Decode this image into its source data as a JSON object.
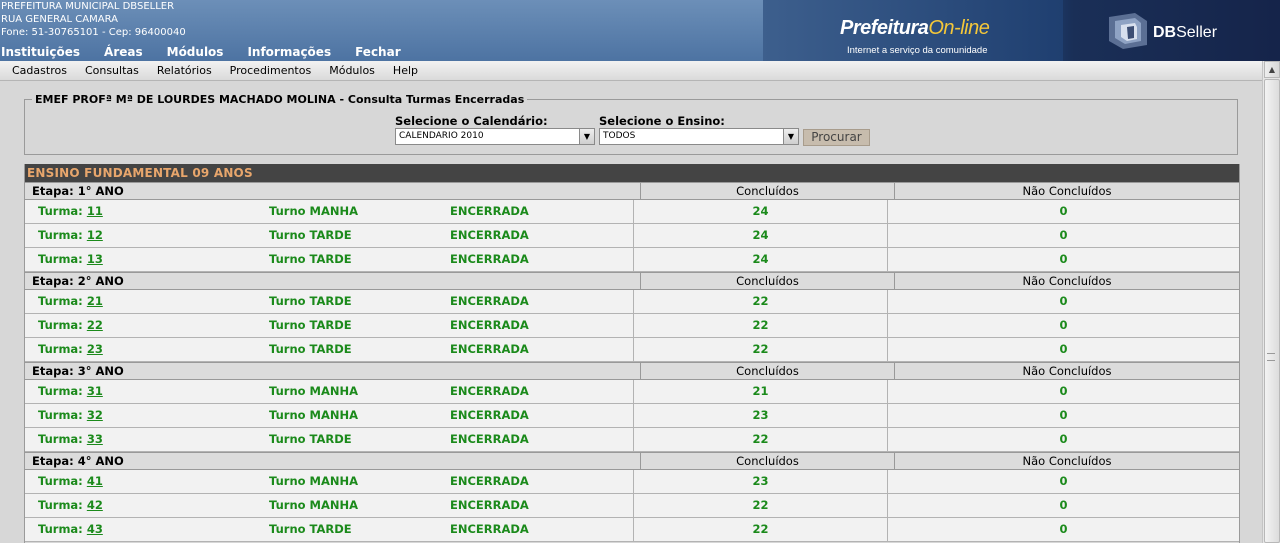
{
  "header": {
    "org_lines": [
      "PREFEITURA MUNICIPAL DBSELLER",
      "RUA GENERAL CAMARA",
      "Fone: 51-30765101  -  Cep: 96400040"
    ],
    "main_menu": [
      "Instituições",
      "Áreas",
      "Módulos",
      "Informações",
      "Fechar"
    ],
    "logo_prefeitura": "Prefeitura",
    "logo_online": "On-line",
    "logo_tagline": "Internet a serviço da comunidade",
    "brand_db": "DB",
    "brand_seller": "Seller"
  },
  "submenu": [
    "Cadastros",
    "Consultas",
    "Relatórios",
    "Procedimentos",
    "Módulos",
    "Help"
  ],
  "form": {
    "legend": "EMEF PROFª Mª DE LOURDES MACHADO MOLINA - Consulta Turmas Encerradas",
    "calendario_label": "Selecione o Calendário:",
    "calendario_value": "CALENDARIO 2010",
    "ensino_label": "Selecione o Ensino:",
    "ensino_value": "TODOS",
    "search_button": "Procurar"
  },
  "table": {
    "ensino_title": "ENSINO FUNDAMENTAL 09 ANOS",
    "col_concluidos": "Concluídos",
    "col_nao_concluidos": "Não Concluídos",
    "turma_prefix": "Turma:",
    "etapas": [
      {
        "name": "Etapa: 1° ANO",
        "turmas": [
          {
            "num": "11",
            "turno": "Turno MANHA",
            "status": "ENCERRADA",
            "concluidos": "24",
            "nao_concluidos": "0"
          },
          {
            "num": "12",
            "turno": "Turno TARDE",
            "status": "ENCERRADA",
            "concluidos": "24",
            "nao_concluidos": "0"
          },
          {
            "num": "13",
            "turno": "Turno TARDE",
            "status": "ENCERRADA",
            "concluidos": "24",
            "nao_concluidos": "0"
          }
        ]
      },
      {
        "name": "Etapa: 2° ANO",
        "turmas": [
          {
            "num": "21",
            "turno": "Turno TARDE",
            "status": "ENCERRADA",
            "concluidos": "22",
            "nao_concluidos": "0"
          },
          {
            "num": "22",
            "turno": "Turno TARDE",
            "status": "ENCERRADA",
            "concluidos": "22",
            "nao_concluidos": "0"
          },
          {
            "num": "23",
            "turno": "Turno TARDE",
            "status": "ENCERRADA",
            "concluidos": "22",
            "nao_concluidos": "0"
          }
        ]
      },
      {
        "name": "Etapa: 3° ANO",
        "turmas": [
          {
            "num": "31",
            "turno": "Turno MANHA",
            "status": "ENCERRADA",
            "concluidos": "21",
            "nao_concluidos": "0"
          },
          {
            "num": "32",
            "turno": "Turno MANHA",
            "status": "ENCERRADA",
            "concluidos": "23",
            "nao_concluidos": "0"
          },
          {
            "num": "33",
            "turno": "Turno TARDE",
            "status": "ENCERRADA",
            "concluidos": "22",
            "nao_concluidos": "0"
          }
        ]
      },
      {
        "name": "Etapa: 4° ANO",
        "turmas": [
          {
            "num": "41",
            "turno": "Turno MANHA",
            "status": "ENCERRADA",
            "concluidos": "23",
            "nao_concluidos": "0"
          },
          {
            "num": "42",
            "turno": "Turno MANHA",
            "status": "ENCERRADA",
            "concluidos": "22",
            "nao_concluidos": "0"
          },
          {
            "num": "43",
            "turno": "Turno TARDE",
            "status": "ENCERRADA",
            "concluidos": "22",
            "nao_concluidos": "0"
          }
        ]
      }
    ]
  },
  "colors": {
    "header_blue": "#5a7fae",
    "ensino_bar": "#444444",
    "ensino_text": "#e8a66c",
    "turma_green": "#1b8a1b",
    "button_bg": "#c7bcad"
  }
}
